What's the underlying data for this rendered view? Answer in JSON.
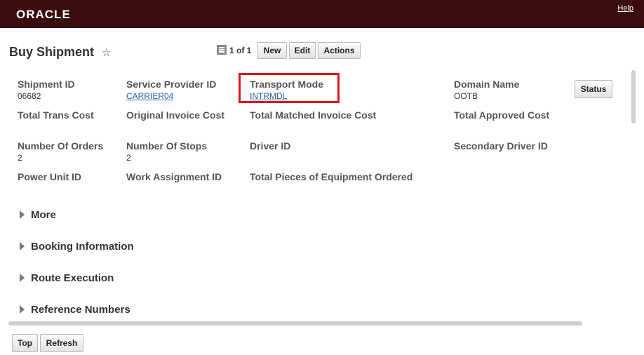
{
  "header": {
    "logo": "ORACLE",
    "help": "Help"
  },
  "page": {
    "title": "Buy Shipment",
    "star_icon": "☆"
  },
  "toolbar": {
    "pager": "1 of 1",
    "new": "New",
    "edit": "Edit",
    "actions": "Actions"
  },
  "status_button": "Status",
  "fields": {
    "shipment_id": {
      "label": "Shipment ID",
      "value": "06682"
    },
    "service_provider_id": {
      "label": "Service Provider ID",
      "value": "CARRIER04"
    },
    "transport_mode": {
      "label": "Transport Mode",
      "value": "INTRMDL"
    },
    "domain_name": {
      "label": "Domain Name",
      "value": "OOTB"
    },
    "total_trans_cost": {
      "label": "Total Trans Cost"
    },
    "original_invoice_cost": {
      "label": "Original Invoice Cost"
    },
    "total_matched_invoice_cost": {
      "label": "Total Matched Invoice Cost"
    },
    "total_approved_cost": {
      "label": "Total Approved Cost"
    },
    "number_of_orders": {
      "label": "Number Of Orders",
      "value": "2"
    },
    "number_of_stops": {
      "label": "Number Of Stops",
      "value": "2"
    },
    "driver_id": {
      "label": "Driver ID"
    },
    "secondary_driver_id": {
      "label": "Secondary Driver ID"
    },
    "power_unit_id": {
      "label": "Power Unit ID"
    },
    "work_assignment_id": {
      "label": "Work Assignment ID"
    },
    "total_pieces_equipment": {
      "label": "Total Pieces of Equipment Ordered"
    }
  },
  "sections": [
    "More",
    "Booking Information",
    "Route Execution",
    "Reference Numbers"
  ],
  "footer": {
    "top": "Top",
    "refresh": "Refresh"
  },
  "colors": {
    "header_bg": "#3a0b0f",
    "highlight": "#e0141e",
    "link": "#2a5ea8"
  }
}
